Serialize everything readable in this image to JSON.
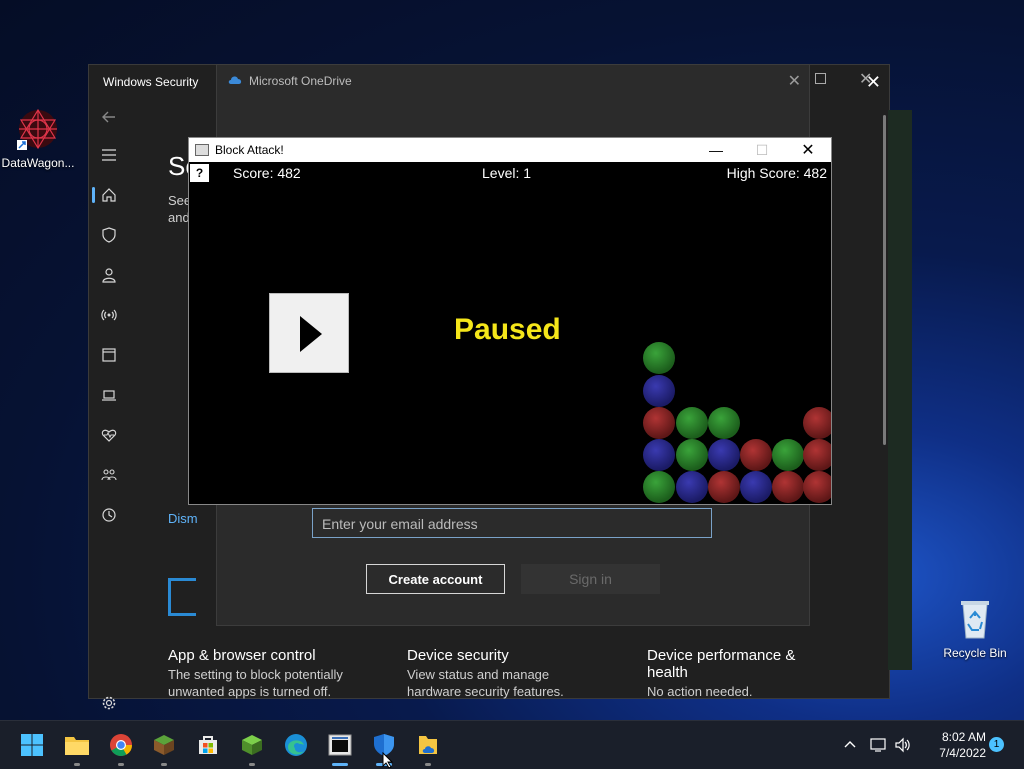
{
  "desktop": {
    "icons": [
      {
        "label": "DataWagon..."
      },
      {
        "label": "Recycle Bin"
      }
    ]
  },
  "windows_security": {
    "title": "Windows Security",
    "heading_partial": "Se",
    "subtext_partial_1": "See",
    "subtext_partial_2": "and",
    "dismiss_partial": "Dism",
    "tiles": [
      {
        "title": "App & browser control",
        "desc": "The setting to block potentially unwanted apps is turned off."
      },
      {
        "title": "Device security",
        "desc": "View status and manage hardware security features."
      },
      {
        "title": "Device performance & health",
        "desc": "No action needed."
      }
    ],
    "rail_icons": [
      "back-arrow-icon",
      "hamburger-menu-icon",
      "home-icon",
      "shield-icon",
      "account-icon",
      "wifi-icon",
      "app-browser-icon",
      "laptop-icon",
      "heart-icon",
      "family-icon",
      "history-icon",
      "settings-icon"
    ]
  },
  "onedrive": {
    "title": "Microsoft OneDrive",
    "email_placeholder": "Enter your email address",
    "create_account": "Create account",
    "sign_in": "Sign in"
  },
  "block_attack": {
    "title": "Block Attack!",
    "help": "?",
    "score": "Score: 482",
    "level": "Level: 1",
    "high_score": "High Score: 482",
    "status": "Paused"
  },
  "taskbar": {
    "time": "8:02 AM",
    "date": "7/4/2022",
    "notification_count": "1",
    "apps": [
      "start",
      "file-explorer",
      "chrome",
      "minecraft",
      "store",
      "minecraft-2",
      "edge",
      "block-attack",
      "windows-security",
      "onedrive"
    ]
  },
  "colors": {
    "paused_text": "#f5e61a",
    "accent": "#5fb3f9"
  }
}
